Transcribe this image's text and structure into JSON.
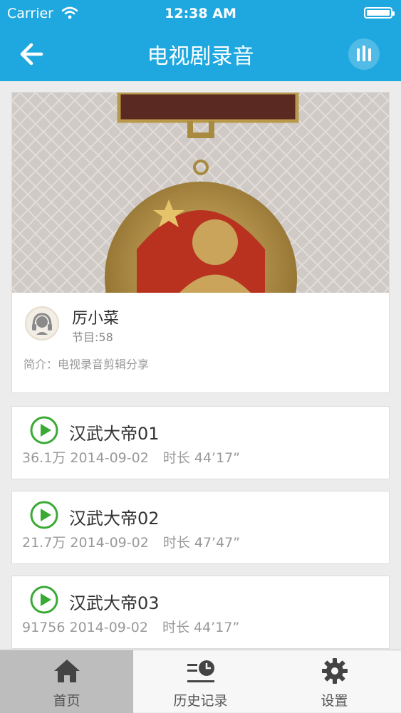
{
  "status_bar": {
    "carrier": "Carrier",
    "time": "12:38 AM"
  },
  "nav": {
    "title": "电视剧录音",
    "back_icon": "back-arrow-icon",
    "playing_icon": "now-playing-icon"
  },
  "profile": {
    "banner_image": "medal-photo",
    "author": "厉小菜",
    "program_count": "节目:58",
    "description": "简介：电视录音剪辑分享"
  },
  "episodes": [
    {
      "title": "汉武大帝01",
      "plays": "36.1万",
      "date": "2014-09-02",
      "duration": "时长 44’17”"
    },
    {
      "title": "汉武大帝02",
      "plays": "21.7万",
      "date": "2014-09-02",
      "duration": "时长 47’47”"
    },
    {
      "title": "汉武大帝03",
      "plays": "91756",
      "date": "2014-09-02",
      "duration": "时长 44’17”"
    }
  ],
  "tabs": [
    {
      "label": "首页",
      "icon": "home-icon",
      "active": true
    },
    {
      "label": "历史记录",
      "icon": "history-icon",
      "active": false
    },
    {
      "label": "设置",
      "icon": "gear-icon",
      "active": false
    }
  ],
  "colors": {
    "accent": "#1fa8df",
    "play_green": "#3aaa35",
    "tab_active_bg": "#bdbdbd"
  }
}
